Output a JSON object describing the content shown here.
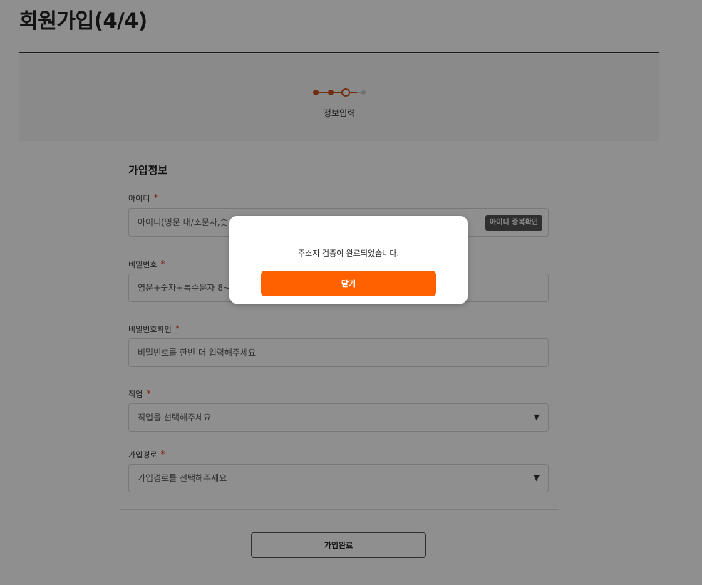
{
  "page": {
    "title": "회원가입(4/4)"
  },
  "steps": {
    "current_label": "정보입력",
    "total": 4,
    "current": 3,
    "accent_color": "#c8531a"
  },
  "form": {
    "section_title": "가입정보",
    "required_mark": "*",
    "id": {
      "label": "아이디",
      "placeholder": "아이디(영문 대/소문자,숫자",
      "check_button": "아이디 중복확인"
    },
    "password": {
      "label": "비밀번호",
      "placeholder": "영문+숫자+특수문자 8~16"
    },
    "password_confirm": {
      "label": "비밀번호확인",
      "placeholder": "비밀번호를 한번 더 입력해주세요"
    },
    "job": {
      "label": "직업",
      "selected": "직업을 선택해주세요",
      "arrow_icon": "▼"
    },
    "join_path": {
      "label": "가입경로",
      "selected": "가입경로를 선택해주세요",
      "arrow_icon": "▼"
    },
    "submit_label": "가입완료"
  },
  "modal": {
    "message": "주소지 검증이 완료되었습니다.",
    "close_label": "닫기",
    "accent_color": "#ff6000"
  }
}
